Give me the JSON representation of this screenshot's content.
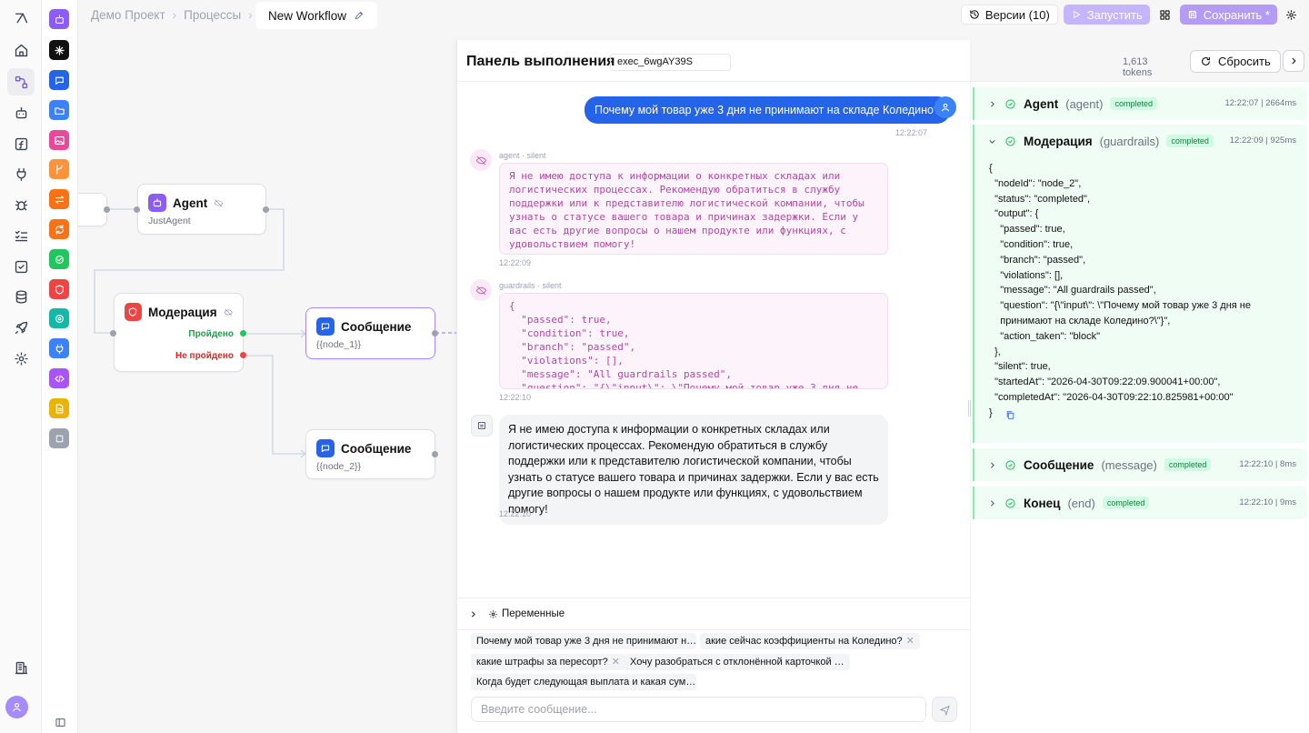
{
  "breadcrumb": {
    "project": "Демо Проект",
    "section": "Процессы",
    "workflow": "New Workflow"
  },
  "toolbar": {
    "versions": "Версии (10)",
    "run": "Запустить",
    "save": "Сохранить *"
  },
  "canvas": {
    "agent_node": {
      "title": "Agent",
      "subtitle": "JustAgent"
    },
    "moderation_node": {
      "title": "Модерация",
      "passed": "Пройдено",
      "failed": "Не пройдено"
    },
    "message_node_1": {
      "title": "Сообщение",
      "subtitle": "{{node_1}}"
    },
    "message_node_2": {
      "title": "Сообщение",
      "subtitle": "{{node_2}}"
    }
  },
  "execution": {
    "title": "Панель выполнения",
    "exec_id": "exec_6wgAY39S",
    "tokens": "1,613 tokens",
    "reset": "Сбросить",
    "user_message": "Почему мой товар уже 3 дня не принимают на складе Коледино?",
    "user_time": "12:22:07",
    "agent_meta": "agent · silent",
    "agent_text": "Я не имею доступа к информации о конкретных складах или логистических процессах. Рекомендую обратиться в службу поддержки или к представителю логистической компании, чтобы узнать о статусе вашего товара и причинах задержки. Если у вас есть другие вопросы о нашем продукте или функциях, с удовольствием помогу!",
    "agent_time": "12:22:09",
    "guard_meta": "guardrails · silent",
    "guard_text": "{\n  \"passed\": true,\n  \"condition\": true,\n  \"branch\": \"passed\",\n  \"violations\": [],\n  \"message\": \"All guardrails passed\",\n  \"question\": \"{\\\"input\\\": \\\"Почему мой товар уже 3 дня не",
    "guard_time": "12:22:10",
    "bot_text": "Я не имею доступа к информации о конкретных складах или логистических процессах. Рекомендую обратиться в службу поддержки или к представителю логистической компании, чтобы узнать о статусе вашего товара и причинах задержки. Если у вас есть другие вопросы о нашем продукте или функциях, с удовольствием помогу!",
    "bot_time": "12:22:10",
    "variables_label": "Переменные",
    "suggestions": [
      "Почему мой товар уже 3 дня не принимают н…",
      "акие сейчас коэффициенты на Коледино?",
      "какие штрафы за пересорт?",
      "Хочу разобраться с отклонённой карточкой …",
      "Когда будет следующая выплата и какая сум…"
    ],
    "input_placeholder": "Введите сообщение..."
  },
  "steps": [
    {
      "name": "Agent",
      "type": "(agent)",
      "status": "completed",
      "time": "12:22:07 | 2664ms"
    },
    {
      "name": "Модерация",
      "type": "(guardrails)",
      "status": "completed",
      "time": "12:22:09 | 925ms",
      "json": "{\n  \"nodeId\": \"node_2\",\n  \"status\": \"completed\",\n  \"output\": {\n    \"passed\": true,\n    \"condition\": true,\n    \"branch\": \"passed\",\n    \"violations\": [],\n    \"message\": \"All guardrails passed\",\n    \"question\": \"{\\\"input\\\": \\\"Почему мой товар уже 3 дня не\n    принимают на складе Коледино?\\\"}\",\n    \"action_taken\": \"block\"\n  },\n  \"silent\": true,\n  \"startedAt\": \"2026-04-30T09:22:09.900041+00:00\",\n  \"completedAt\": \"2026-04-30T09:22:10.825981+00:00\"\n}"
    },
    {
      "name": "Сообщение",
      "type": "(message)",
      "status": "completed",
      "time": "12:22:10 | 8ms"
    },
    {
      "name": "Конец",
      "type": "(end)",
      "status": "completed",
      "time": "12:22:10 | 9ms"
    }
  ],
  "colors": {
    "accent": "#8b5cf6",
    "user_bubble": "#2563eb",
    "success": "#22c55e",
    "fail": "#ef4444"
  }
}
